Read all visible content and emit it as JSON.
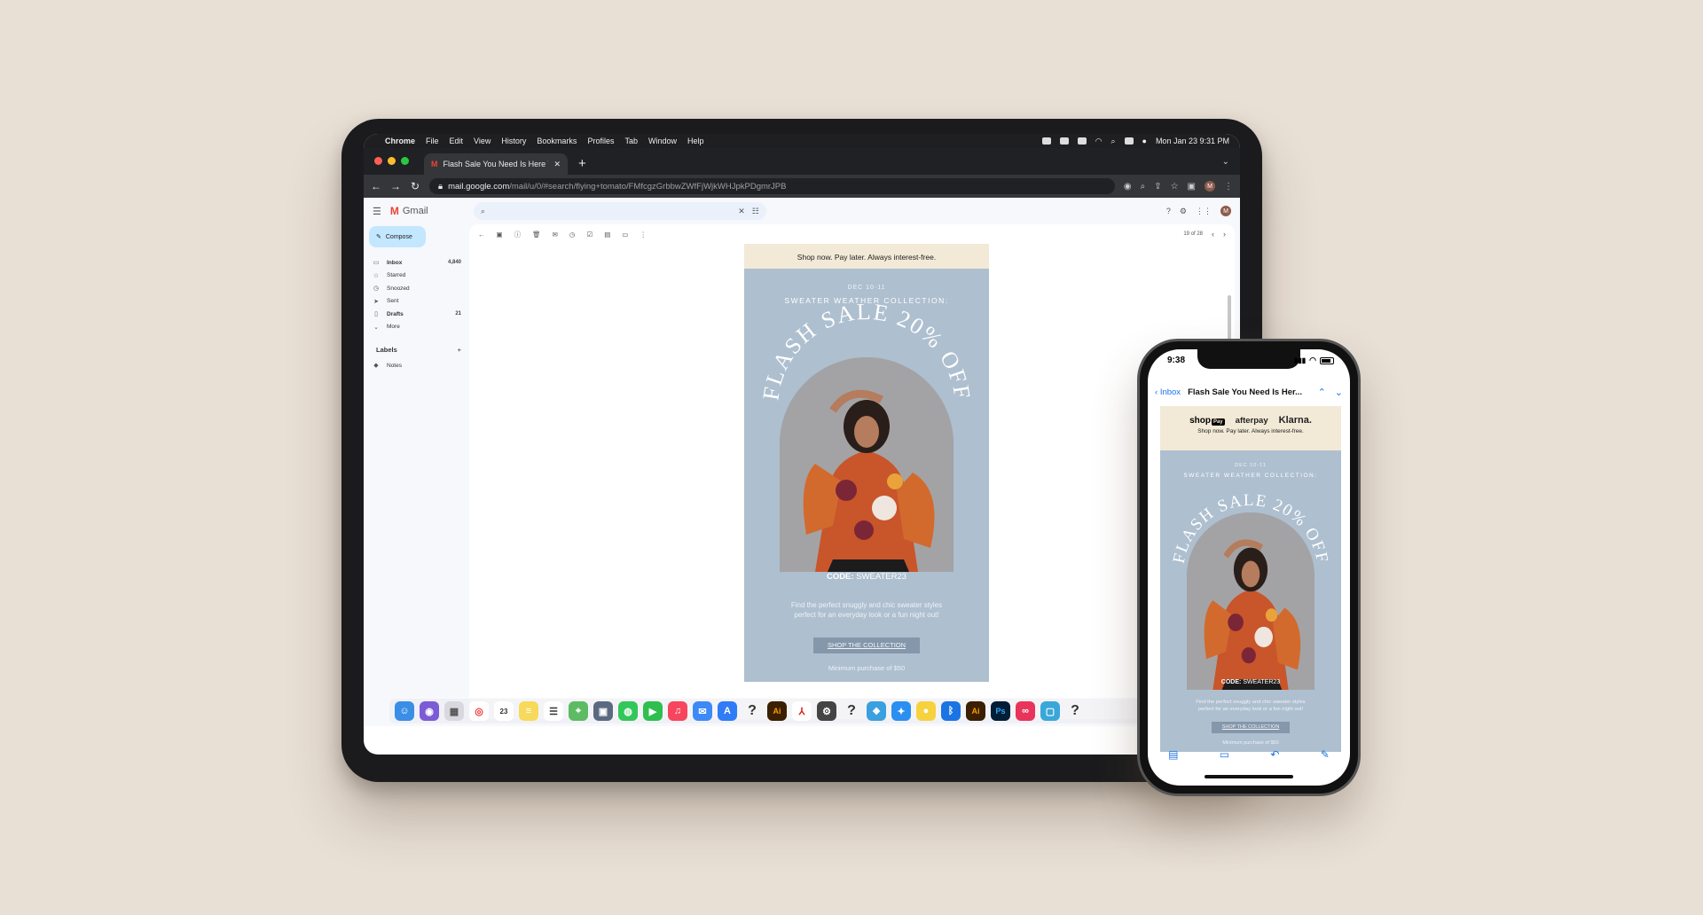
{
  "mac": {
    "menus": [
      "Chrome",
      "File",
      "Edit",
      "View",
      "History",
      "Bookmarks",
      "Profiles",
      "Tab",
      "Window",
      "Help"
    ],
    "datetime": "Mon Jan 23  9:31 PM"
  },
  "chrome": {
    "tab_title": "Flash Sale You Need Is Here W",
    "url_host": "mail.google.com",
    "url_path": "/mail/u/0/#search/flying+tomato/FMfcgzGrbbwZWfFjWjkWHJpkPDgmrJPB",
    "profile_initial": "M"
  },
  "gmail": {
    "product_name": "Gmail",
    "compose_label": "Compose",
    "nav": [
      {
        "label": "Inbox",
        "count": "4,840"
      },
      {
        "label": "Starred",
        "count": ""
      },
      {
        "label": "Snoozed",
        "count": ""
      },
      {
        "label": "Sent",
        "count": ""
      },
      {
        "label": "Drafts",
        "count": "21"
      },
      {
        "label": "More",
        "count": ""
      }
    ],
    "labels_heading": "Labels",
    "labels": [
      "Notes"
    ],
    "pager": "19 of 28"
  },
  "email": {
    "promo_line": "Shop now. Pay later. Always interest-free.",
    "date": "DEC 10-11",
    "collection": "SWEATER  WEATHER COLLECTION:",
    "headline": "FLASH SALE 20% OFF",
    "code_label": "CODE:",
    "code_value": "SWEATER23",
    "body_line1": "Find the perfect snuggly and chic sweater styles",
    "body_line2": "perfect for an everyday look or a fun night out!",
    "cta": "SHOP THE COLLECTION",
    "minimum": "Minimum purchase of $50",
    "payments": {
      "shop": "shop",
      "shop_badge": "Pay",
      "afterpay": "afterpay",
      "klarna": "Klarna."
    }
  },
  "phone": {
    "time": "9:38",
    "back_label": "Inbox",
    "subject": "Flash Sale You Need Is Her..."
  },
  "colors": {
    "background": "#e8dfd5",
    "email_blue": "#aebfcf",
    "promo_cream": "#f2ead7",
    "cta": "#8497ab",
    "ios_blue": "#1a73e8"
  }
}
